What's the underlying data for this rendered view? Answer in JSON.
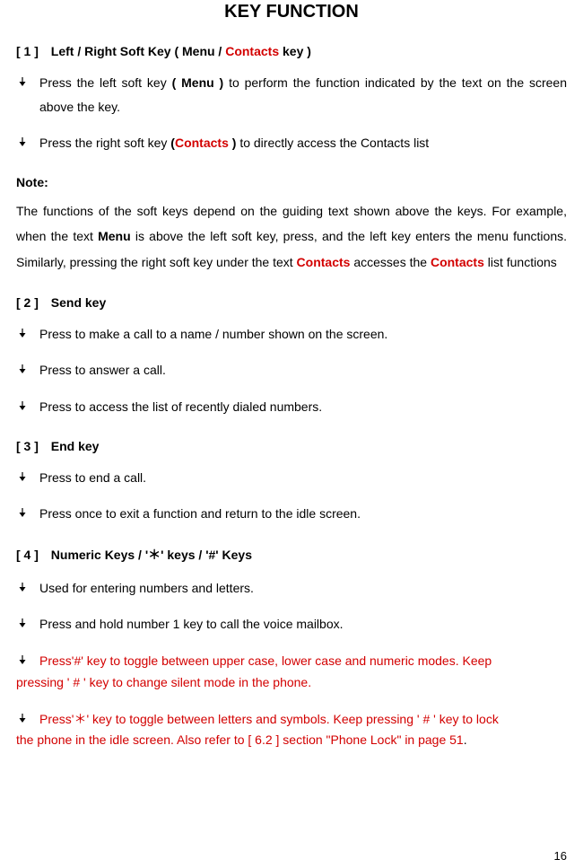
{
  "title": "KEY FUNCTION",
  "sec1": {
    "num": "[ 1 ]",
    "h_pre": "Left / Right Soft Key ( Menu / ",
    "h_red": "Contacts",
    "h_post": " key )",
    "b1_a": "Press the left soft key ",
    "b1_b": "( Menu )",
    "b1_c": " to perform the function indicated by the text on the screen above the key.",
    "b2_a": "Press the right soft key ",
    "b2_b_paren": "(",
    "b2_b_red": "Contacts ",
    "b2_b_paren2": ")",
    "b2_c": " to directly access the Contacts list"
  },
  "note": {
    "label": "Note:",
    "p1": "The functions of the soft keys depend on the guiding text shown above the keys. For example, when the text ",
    "p1_b": "Menu",
    "p2": " is above the left soft key, press, and the left key enters the menu functions. Similarly, pressing the right soft key under the text ",
    "p2_red": "Contacts",
    "p3": " accesses the ",
    "p3_red": "Contacts",
    "p4": " list functions"
  },
  "sec2": {
    "num": "[ 2 ]",
    "h": "Send key",
    "b1": "Press to make a call to a name / number shown on the screen.",
    "b2": "Press to answer a call.",
    "b3": "Press to access the list of recently dialed numbers."
  },
  "sec3": {
    "num": "[ 3 ]",
    "h": "End key",
    "b1": "Press to end a call.",
    "b2": "Press once to exit a function and return to the idle screen."
  },
  "sec4": {
    "num": "[ 4 ]",
    "h": "Numeric Keys / '＊' keys / '#' Keys",
    "b1": "Used for entering numbers and letters.",
    "b2": "Press and hold number 1 key to call the voice mailbox.",
    "b3": "Press'#' key to toggle between upper case, lower case and numeric modes. Keep",
    "b3_cont": "pressing ' # ' key to change silent mode in the phone.",
    "b4": "Press'＊' key to toggle between letters and symbols. Keep pressing ' # ' key to lock",
    "b4_cont": "the phone in the idle screen. Also refer to [ 6.2 ] section \"Phone Lock\" in page 51"
  },
  "pagenum": "16"
}
